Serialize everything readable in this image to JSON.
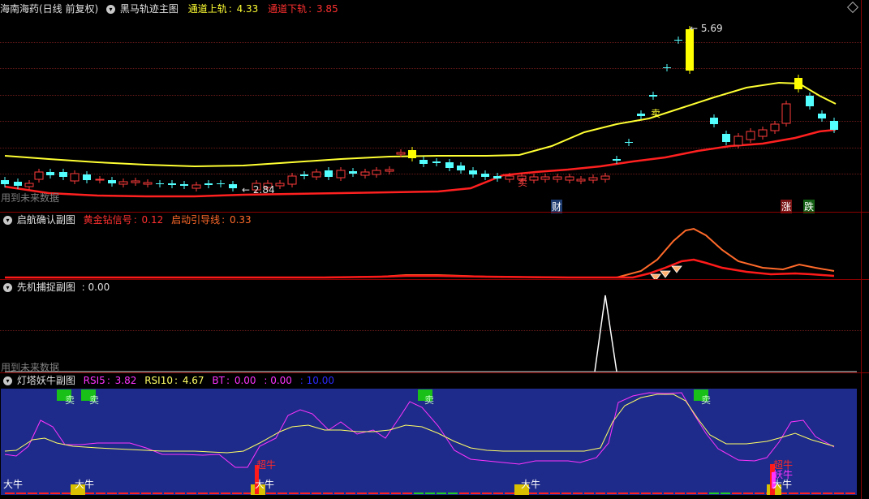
{
  "main": {
    "stock_name": "海南海药(日线 前复权)",
    "indicator_name": "黑马轨迹主图",
    "upper_label": "通道上轨",
    "upper_value": "4.33",
    "lower_label": "通道下轨",
    "lower_value": "3.85",
    "high_price": "5.69",
    "low_price": "2.84",
    "future_notice": "用到未来数据",
    "marker_sell_1": "卖",
    "marker_sell_2": "卖",
    "badge_cai": "财",
    "badge_zhang": "涨",
    "badge_die": "跌"
  },
  "sub1": {
    "name": "启航确认副图",
    "gold_label": "黄金钻信号",
    "gold_value": "0.12",
    "guide_label": "启动引导线",
    "guide_value": "0.33"
  },
  "sub2": {
    "name": "先机捕捉副图",
    "value": ": 0.00",
    "future_notice": "用到未来数据"
  },
  "sub3": {
    "name": "灯塔妖牛副图",
    "rsi5_label": "RSI5",
    "rsi5_value": "3.82",
    "rsi10_label": "RSI10",
    "rsi10_value": "4.67",
    "bt_label": "BT",
    "bt_value": "0.00",
    "v1": ": 0.00",
    "v2": ": 10.00",
    "sell_labels": [
      "卖",
      "卖",
      "卖",
      "卖"
    ],
    "big_bull_labels": [
      "大牛",
      "大牛",
      "大牛",
      "大牛",
      "大牛"
    ],
    "super_bull_labels": [
      "超牛",
      "超牛"
    ],
    "demon_bull_label": "妖牛"
  },
  "colors": {
    "upper_band": "#ffff33",
    "lower_band": "#ff2020",
    "candle_up": "#ff3b3b",
    "candle_down": "#54ffff",
    "rsi5": "#ff33ff",
    "rsi10": "#ffff66",
    "panel_bg": "#1f2b8a"
  }
}
